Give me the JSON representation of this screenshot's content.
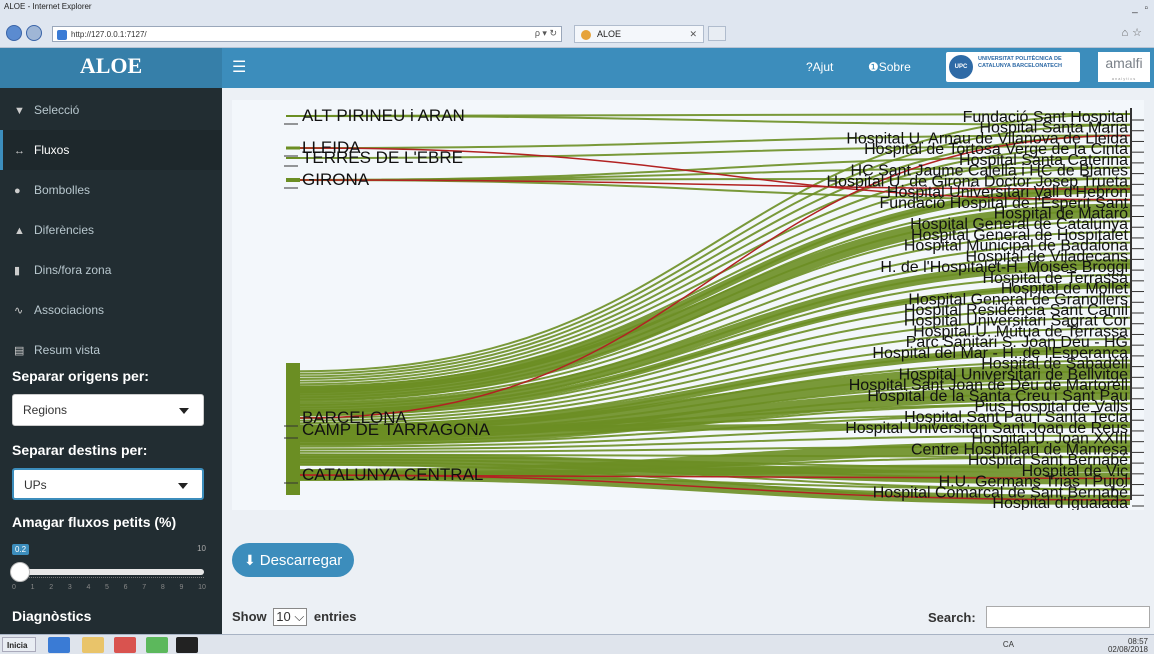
{
  "browser": {
    "window_title": "ALOE - Internet Explorer",
    "address": "http://127.0.0.1:7127/",
    "tab_title": "ALOE",
    "window_buttons": "_ ▫"
  },
  "app": {
    "brand": "ALOE",
    "topbar": {
      "help": "?Ajut",
      "about": "❶Sobre",
      "upc_logo_text": "UNIVERSITAT POLITÈCNICA DE CATALUNYA BARCELONATECH",
      "upc_abbr": "UPC",
      "amalfi_logo": "amalfi",
      "amalfi_sub": "analytics"
    }
  },
  "sidebar": {
    "items": [
      {
        "icon": "▼",
        "label": "Selecció"
      },
      {
        "icon": "↔",
        "label": "Fluxos"
      },
      {
        "icon": "●",
        "label": "Bombolles"
      },
      {
        "icon": "▲",
        "label": "Diferències"
      },
      {
        "icon": "▮",
        "label": "Dins/fora zona"
      },
      {
        "icon": "∿",
        "label": "Associacions"
      },
      {
        "icon": "▤",
        "label": "Resum vista"
      }
    ],
    "origins_label": "Separar origens per:",
    "origins_value": "Regions",
    "dest_label": "Separar destins per:",
    "dest_value": "UPs",
    "hide_label": "Amagar fluxos petits (%)",
    "slider_value": "0.2",
    "slider_max": "10",
    "slider_ticks": [
      "0",
      "1",
      "2",
      "3",
      "4",
      "5",
      "6",
      "7",
      "8",
      "9",
      "10"
    ],
    "diag_label": "Diagnòstics"
  },
  "chart_data": {
    "type": "sankey",
    "sources": [
      "ALT PIRINEU i ARAN",
      "LLEIDA",
      "TERRES DE L'EBRE",
      "GIRONA",
      "BARCELONA",
      "CAMP DE TARRAGONA",
      "CATALUNYA CENTRAL"
    ],
    "targets": [
      "Fundació Sant Hospital",
      "Hospital Santa Maria",
      "Hospital U. Arnau de Vilanova de Lleida",
      "Hospital de Tortosa Verge de la Cinta",
      "Hospital Santa Caterina",
      "HC Sant Jaume Calella i HC de Blanes",
      "Hospital U. de Girona Doctor Josep Trueta",
      "Hospital Universitari Vall d'Hebron",
      "Fundació Hospital de l'Esperit Sant",
      "Hospital de Mataró",
      "Hospital General de Catalunya",
      "Hospital General de Hospitalet",
      "Hospital Municipal de Badalona",
      "Hospital de Viladecans",
      "H. de l'Hospitalet-H. Moisès Broggi",
      "Hospital de Terrassa",
      "Hospital de Mollet",
      "Hospital General de Granollers",
      "Hospital Residència Sant Camil",
      "Hospital Universitari Sagrat Cor",
      "Hospital U. Mútua de Terrassa",
      "Parc Sanitari S. Joan Déu - HG",
      "Hospital del Mar - H. de l'Esperança",
      "Hospital de Sabadell",
      "Hospital Universitari de Bellvitge",
      "Hospital Sant Joan de Déu de Martorell",
      "Hospital de la Santa Creu i Sant Pau",
      "Pius Hospital de Valls",
      "Hospital Sant Pau i Santa Tecla",
      "Hospital Universitari Sant Joan de Reus",
      "Hospital U. Joan XXIII",
      "Centre Hospitalari de Manresa",
      "Hospital Sant Bernabé",
      "Hospital de Vic",
      "H.U. Germans Trias i Pujol",
      "Hospital Comarcal de Sant Bernabé",
      "Hospital d'Igualada"
    ]
  },
  "content": {
    "download_label": "Descarregar",
    "show_label": "Show",
    "entries_value": "10",
    "entries_label": "entries",
    "search_label": "Search:"
  },
  "taskbar": {
    "start": "Inicia",
    "lang": "CA",
    "time": "08:57",
    "date": "02/08/2018"
  },
  "colors": {
    "flow_green": "#6b8e23",
    "flow_red": "#b22222",
    "primary": "#3c8dbc",
    "sidebar": "#222d32"
  }
}
